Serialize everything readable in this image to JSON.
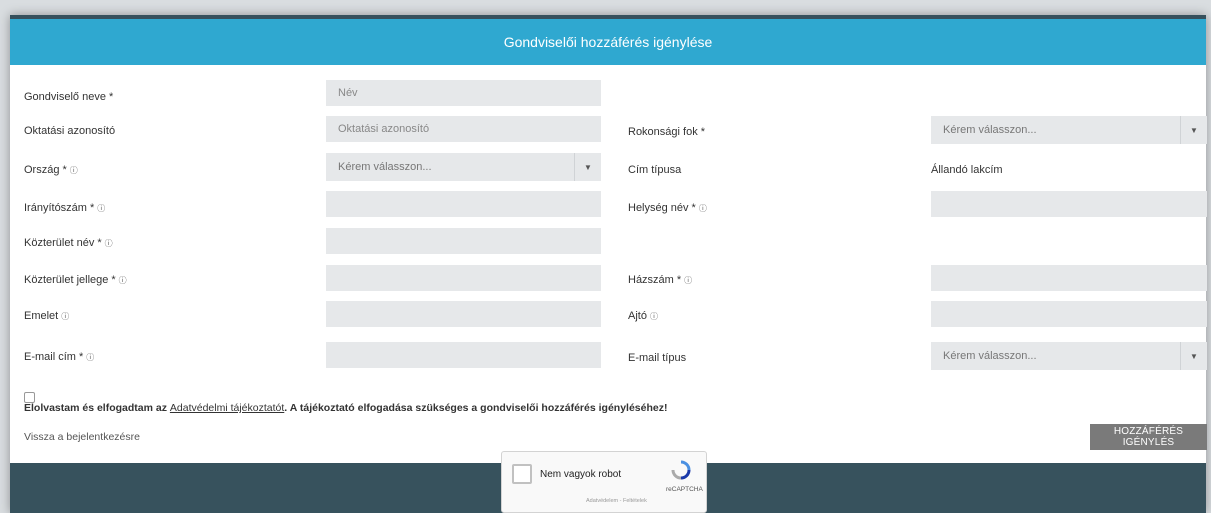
{
  "header": {
    "title": "Gondviselői hozzáférés igénylése"
  },
  "fields": {
    "name": {
      "label": "Gondviselő neve",
      "required": "*",
      "placeholder": "Név"
    },
    "edu_id": {
      "label": "Oktatási azonosító",
      "placeholder": "Oktatási azonosító"
    },
    "relation": {
      "label": "Rokonsági fok",
      "required": "*",
      "value": "Kérem válasszon..."
    },
    "country": {
      "label": "Ország",
      "required": "*",
      "value": "Kérem válasszon..."
    },
    "address_type": {
      "label": "Cím típusa",
      "value": "Állandó lakcím"
    },
    "zip": {
      "label": "Irányítószám",
      "required": "*"
    },
    "city": {
      "label": "Helység név",
      "required": "*"
    },
    "street": {
      "label": "Közterület név",
      "required": "*"
    },
    "street_type": {
      "label": "Közterület jellege",
      "required": "*"
    },
    "house_no": {
      "label": "Házszám",
      "required": "*"
    },
    "floor": {
      "label": "Emelet"
    },
    "door": {
      "label": "Ajtó"
    },
    "email": {
      "label": "E-mail cím",
      "required": "*"
    },
    "email_type": {
      "label": "E-mail típus",
      "value": "Kérem válasszon..."
    }
  },
  "info_icon": "ⓘ",
  "consent": {
    "prefix": "Elolvastam és elfogadtam az ",
    "link": "Adatvédelmi tájékoztatót",
    "suffix": ". A tájékoztató elfogadása szükséges a gondviselői hozzáférés igényléséhez!"
  },
  "back_link": "Vissza a bejelentkezésre",
  "submit_label": "HOZZÁFÉRÉS IGÉNYLÉS",
  "captcha": {
    "label": "Nem vagyok robot",
    "brand": "reCAPTCHA",
    "terms": "Adatvédelem - Feltételek"
  },
  "colors": {
    "header": "#2fa8d0",
    "footer": "#37525d",
    "input_bg": "#e6e8ea",
    "button": "#7a7a7a"
  }
}
